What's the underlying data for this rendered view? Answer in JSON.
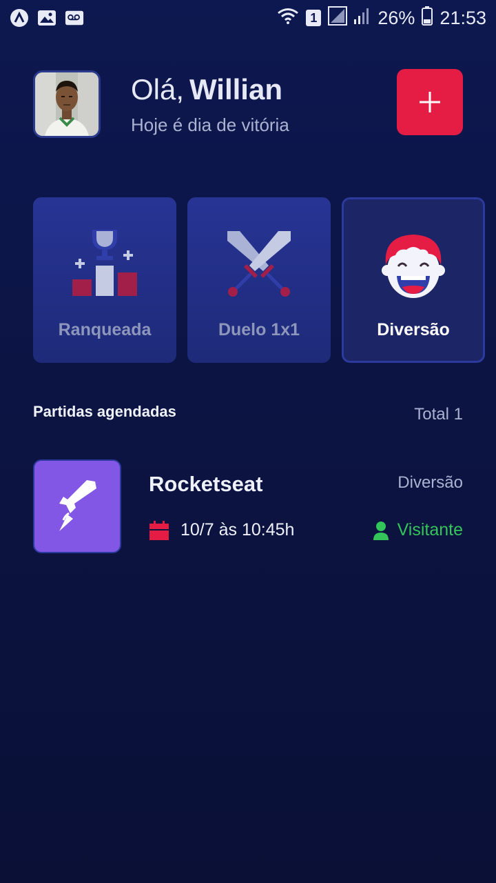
{
  "status_bar": {
    "sim_label": "1",
    "battery": "26%",
    "time": "21:53"
  },
  "header": {
    "greeting": "Olá,",
    "user_name": "Willian",
    "subtitle": "Hoje é dia de vitória"
  },
  "categories": [
    {
      "label": "Ranqueada",
      "icon": "ranking-podium-icon",
      "selected": false
    },
    {
      "label": "Duelo 1x1",
      "icon": "crossed-swords-icon",
      "selected": false
    },
    {
      "label": "Diversão",
      "icon": "laughing-face-icon",
      "selected": true
    }
  ],
  "matches": {
    "title": "Partidas agendadas",
    "total": "Total 1",
    "items": [
      {
        "guild": "Rocketseat",
        "category": "Diversão",
        "datetime": "10/7 às 10:45h",
        "role": "Visitante"
      }
    ]
  },
  "colors": {
    "background": "#0c1443",
    "accent": "#e51c44",
    "card": "#24318a",
    "guild_logo": "#8257e5",
    "role_visitor": "#33c45a"
  }
}
